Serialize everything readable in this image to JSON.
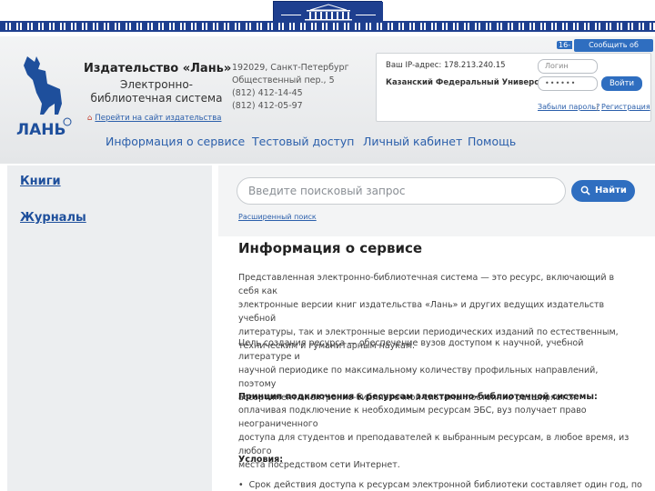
{
  "banner": {
    "emblem_icon": "building-emblem-icon"
  },
  "report": {
    "prefix": "16-",
    "label": "Сообщить об ошибке"
  },
  "publisher": {
    "title": "Издательство «Лань»",
    "subtitle": "Электронно-библиотечная система",
    "site_link": "Перейти на сайт издательства",
    "logo_text": "ЛАНЬ"
  },
  "address": {
    "line1": "192029, Санкт-Петербург",
    "line2": "Общественный пер., 5",
    "phone1": "(812) 412-14-45",
    "phone2": "(812) 412-05-97"
  },
  "auth": {
    "ip": "Ваш IP-адрес: 178.213.240.15",
    "university": "Казанский Федеральный Университет",
    "login_placeholder": "Логин",
    "password_value": "••••••",
    "login_button": "Войти",
    "forgot": "Забыли пароль?",
    "separator": "|",
    "register": "Регистрация"
  },
  "nav": {
    "items": [
      "Информация о сервисе",
      "Тестовый доступ",
      "Личный кабинет",
      "Помощь"
    ]
  },
  "sidebar": {
    "items": [
      "Книги",
      "Журналы"
    ]
  },
  "search": {
    "placeholder": "Введите поисковый запрос",
    "button": "Найти",
    "advanced": "Расширенный поиск"
  },
  "content": {
    "title": "Информация о сервисе",
    "p1": [
      "Представленная электронно-библиотечная система — это ресурс, включающий в себя как",
      "электронные версии книг издательства «Лань» и других ведущих издательств учебной",
      "литературы, так и электронные версии периодических изданий по естественным,",
      "техническим и гуманитарным наукам."
    ],
    "p2": [
      "Цель создания ресурса — обеспечение вузов доступом к научной, учебной литературе и",
      "научной периодике по максимальному количеству профильных направлений, поэтому",
      "ассортимент электронно-библиотечной системы постоянно расширяется."
    ],
    "p3_title": "Принцип подключения к ресурсам электронно-библиотечной системы:",
    "p3": [
      "оплачивая подключение к необходимым ресурсам ЭБС, вуз получает право неограниченного",
      "доступа для студентов и преподавателей к выбранным ресурсам, в любое время, из любого",
      "места посредством сети Интернет."
    ],
    "conditions_title": "Условия:",
    "bullet1": "Срок действия доступа к ресурсам электронной библиотеки составляет один год, по"
  }
}
